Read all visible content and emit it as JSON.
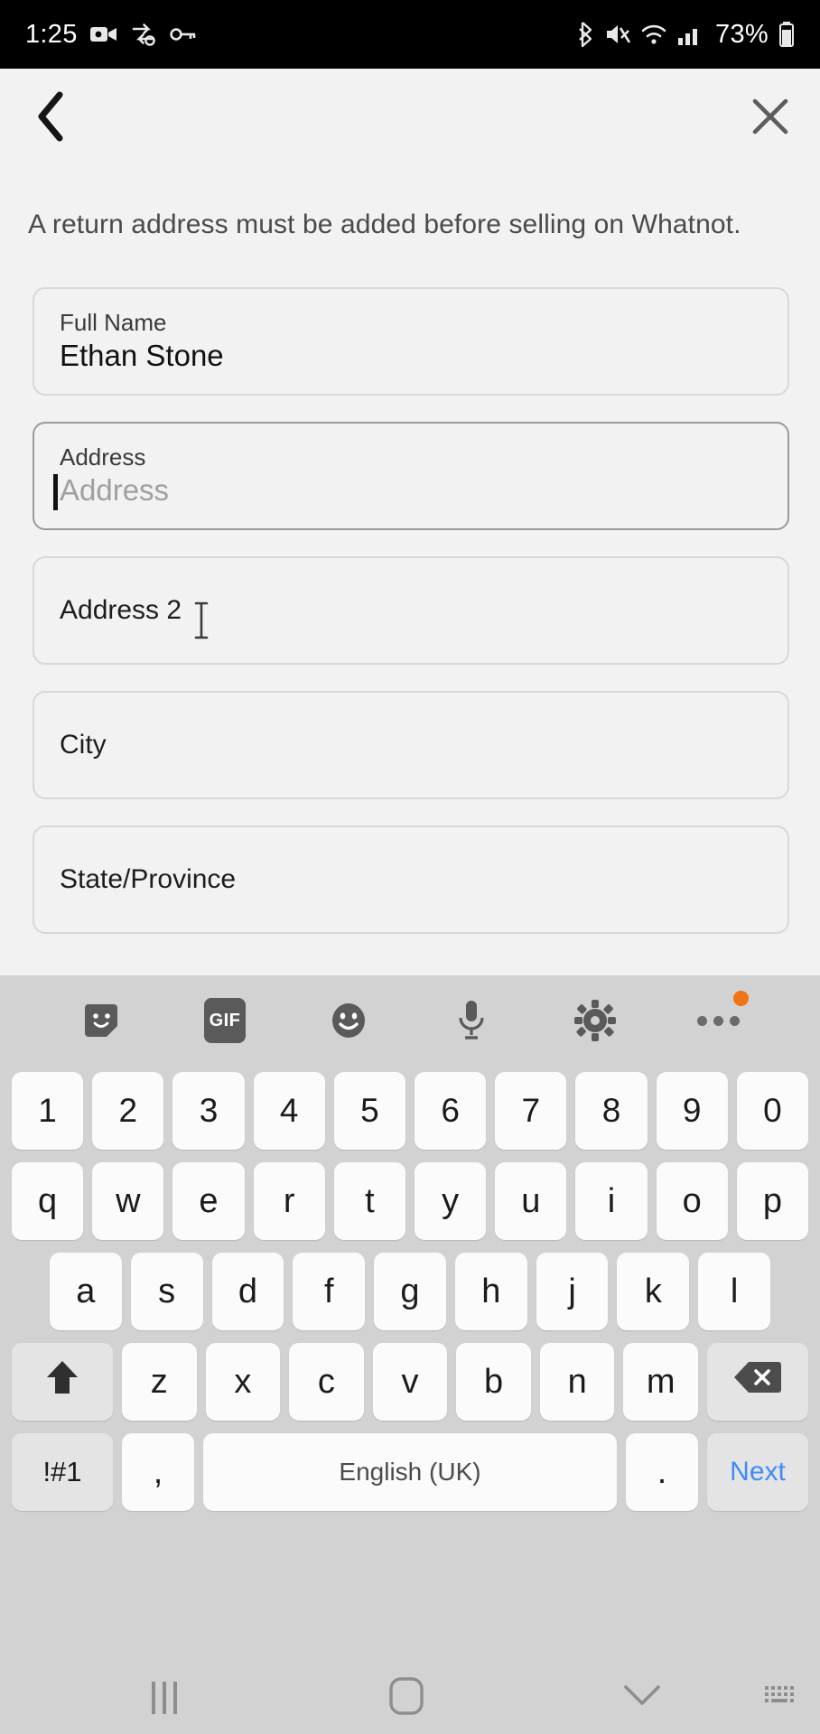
{
  "status_bar": {
    "time": "1:25",
    "battery_percent": "73%",
    "left_icons": [
      "camera-icon",
      "vpn-key-exchange-icon",
      "key-icon"
    ],
    "right_icons": [
      "bluetooth-icon",
      "mute-icon",
      "wifi-icon",
      "cellular-signal-icon",
      "battery-icon"
    ]
  },
  "header": {
    "back_icon": "chevron-left-icon",
    "close_icon": "close-x-icon"
  },
  "notice": {
    "text": "A return address must be added before selling on Whatnot."
  },
  "form": {
    "fields": [
      {
        "name": "full-name",
        "label": "Full Name",
        "value": "Ethan Stone",
        "placeholder": "",
        "state": "filled"
      },
      {
        "name": "address",
        "label": "Address",
        "value": "",
        "placeholder": "Address",
        "state": "focused"
      },
      {
        "name": "address-2",
        "label": "Address 2",
        "value": "",
        "placeholder": "Address 2",
        "state": "empty"
      },
      {
        "name": "city",
        "label": "City",
        "value": "",
        "placeholder": "City",
        "state": "empty"
      },
      {
        "name": "state-province",
        "label": "State/Province",
        "value": "",
        "placeholder": "State/Province",
        "state": "empty"
      }
    ]
  },
  "keyboard": {
    "toolbar": [
      {
        "name": "sticker-icon",
        "label": ""
      },
      {
        "name": "gif-icon",
        "label": "GIF"
      },
      {
        "name": "emoji-icon",
        "label": ""
      },
      {
        "name": "microphone-icon",
        "label": ""
      },
      {
        "name": "gear-icon",
        "label": ""
      },
      {
        "name": "more-options-icon",
        "label": "",
        "badge": true
      }
    ],
    "row_digits": [
      "1",
      "2",
      "3",
      "4",
      "5",
      "6",
      "7",
      "8",
      "9",
      "0"
    ],
    "row_top": [
      "q",
      "w",
      "e",
      "r",
      "t",
      "y",
      "u",
      "i",
      "o",
      "p"
    ],
    "row_home": [
      "a",
      "s",
      "d",
      "f",
      "g",
      "h",
      "j",
      "k",
      "l"
    ],
    "row_bottom": [
      "z",
      "x",
      "c",
      "v",
      "b",
      "n",
      "m"
    ],
    "shift_icon": "shift-up-arrow-icon",
    "backspace_icon": "backspace-icon",
    "symbols_label": "!#1",
    "comma_label": ",",
    "space_label": "English (UK)",
    "period_label": ".",
    "next_label": "Next"
  },
  "nav_bar": {
    "recents_icon": "recents-icon",
    "home_icon": "home-icon",
    "hide_keyboard_icon": "chevron-down-icon",
    "switch_keyboard_icon": "keyboard-icon"
  },
  "colors": {
    "page_bg": "#f2f2f2",
    "status_bg": "#000000",
    "keyboard_bg": "#d2d2d2",
    "key_bg": "#fbfbfb",
    "accent_blue": "#3d8bfd",
    "badge_orange": "#f07314"
  }
}
